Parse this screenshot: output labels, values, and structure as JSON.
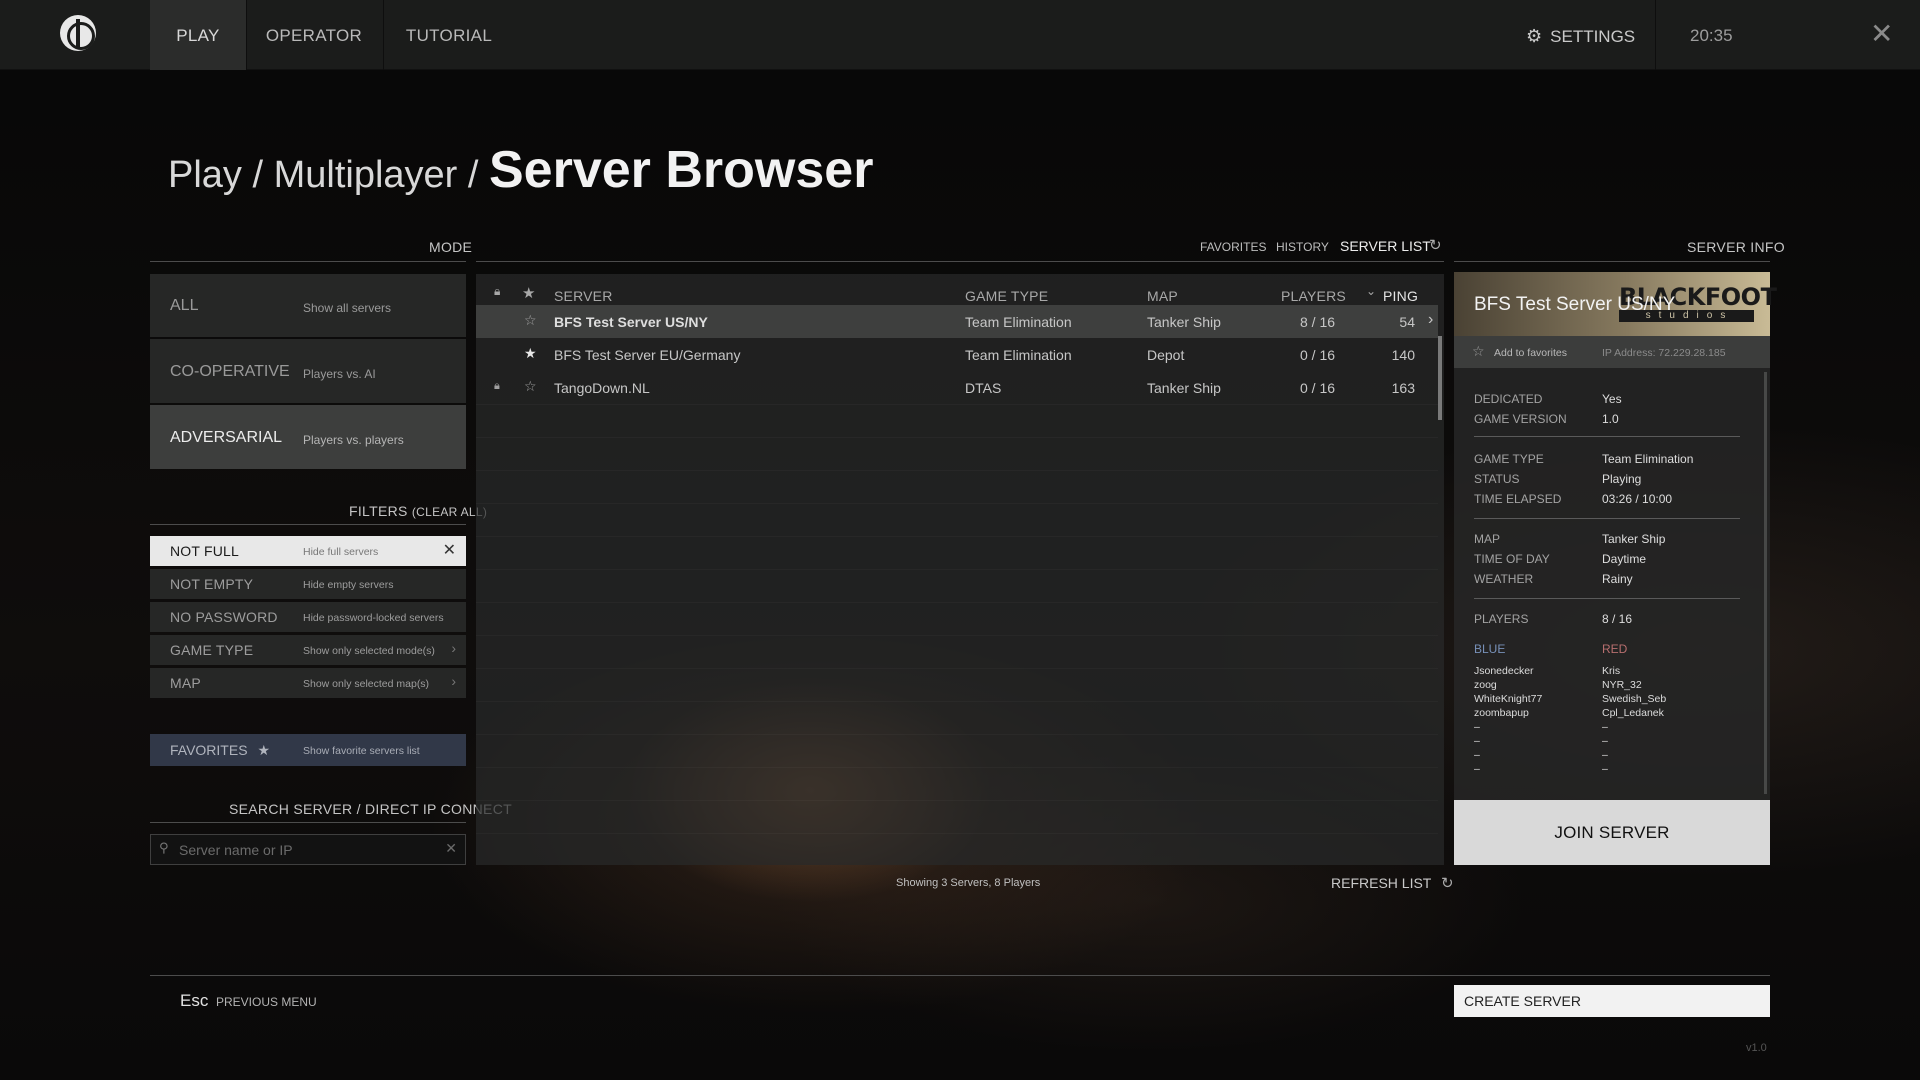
{
  "topbar": {
    "tabs": [
      {
        "label": "PLAY",
        "active": true
      },
      {
        "label": "OPERATOR",
        "active": false
      },
      {
        "label": "TUTORIAL",
        "active": false
      }
    ],
    "settings_label": "SETTINGS",
    "settings_icon": "gear-icon",
    "clock": "20:35",
    "close_icon": "close-icon"
  },
  "title": {
    "breadcrumb": "Play / Multiplayer / ",
    "main": "Server Browser"
  },
  "mode": {
    "header": "MODE",
    "items": [
      {
        "label": "ALL",
        "desc": "Show all servers",
        "active": false
      },
      {
        "label": "CO-OPERATIVE",
        "desc": "Players vs. AI",
        "active": false
      },
      {
        "label": "ADVERSARIAL",
        "desc": "Players vs. players",
        "active": true
      }
    ]
  },
  "filters": {
    "header": "FILTERS",
    "clear_all": "(CLEAR ALL)",
    "items": [
      {
        "label": "NOT FULL",
        "desc": "Hide full servers",
        "active": true,
        "icon": "close-icon",
        "glyph": "✕"
      },
      {
        "label": "NOT EMPTY",
        "desc": "Hide empty servers",
        "active": false,
        "icon": "",
        "glyph": ""
      },
      {
        "label": "NO PASSWORD",
        "desc": "Hide password-locked servers",
        "active": false,
        "icon": "",
        "glyph": ""
      },
      {
        "label": "GAME TYPE",
        "desc": "Show only selected mode(s)",
        "active": false,
        "icon": "chevron-right-icon",
        "glyph": "›"
      },
      {
        "label": "MAP",
        "desc": "Show only selected map(s)",
        "active": false,
        "icon": "chevron-right-icon",
        "glyph": "›"
      }
    ],
    "favorites": {
      "label": "FAVORITES",
      "desc": "Show favorite servers list",
      "icon": "star-icon"
    }
  },
  "search": {
    "header": "SEARCH SERVER / DIRECT IP CONNECT",
    "placeholder": "Server name or IP",
    "value": ""
  },
  "server_list": {
    "tabs": [
      {
        "label": "FAVORITES",
        "active": false
      },
      {
        "label": "HISTORY",
        "active": false
      },
      {
        "label": "SERVER LIST",
        "active": true
      }
    ],
    "columns": {
      "server": "SERVER",
      "game_type": "GAME TYPE",
      "map": "MAP",
      "players": "PLAYERS",
      "ping": "PING",
      "sort_indicator": "⌄"
    },
    "rows": [
      {
        "locked": false,
        "favorite": false,
        "name": "BFS Test Server US/NY",
        "game_type": "Team Elimination",
        "map": "Tanker Ship",
        "players": "8 / 16",
        "ping": "54",
        "selected": true
      },
      {
        "locked": false,
        "favorite": true,
        "name": "BFS Test Server EU/Germany",
        "game_type": "Team Elimination",
        "map": "Depot",
        "players": "0 / 16",
        "ping": "140",
        "selected": false
      },
      {
        "locked": true,
        "favorite": false,
        "name": "TangoDown.NL",
        "game_type": "DTAS",
        "map": "Tanker Ship",
        "players": "0 / 16",
        "ping": "163",
        "selected": false
      }
    ],
    "footer_count": "Showing 3 Servers, 8 Players",
    "refresh_label": "REFRESH LIST"
  },
  "server_info": {
    "header": "SERVER INFO",
    "name": "BFS Test Server US/NY",
    "logo_top": "BLACKFOOT",
    "logo_bottom": "studios",
    "add_favorites": "Add to favorites",
    "ip": "IP Address: 72.229.28.185",
    "details": [
      {
        "key": "DEDICATED",
        "value": "Yes"
      },
      {
        "key": "GAME VERSION",
        "value": "1.0"
      },
      {
        "key": "GAME TYPE",
        "value": "Team Elimination"
      },
      {
        "key": "STATUS",
        "value": "Playing"
      },
      {
        "key": "TIME ELAPSED",
        "value": "03:26 / 10:00"
      },
      {
        "key": "MAP",
        "value": "Tanker Ship"
      },
      {
        "key": "TIME OF DAY",
        "value": "Daytime"
      },
      {
        "key": "WEATHER",
        "value": "Rainy"
      },
      {
        "key": "PLAYERS",
        "value": "8 / 16"
      }
    ],
    "team_blue": "BLUE",
    "team_red": "RED",
    "blue_players": [
      "Jsonedecker",
      "zoog",
      "WhiteKnight77",
      "zoombapup",
      "–",
      "–",
      "–",
      "–"
    ],
    "red_players": [
      "Kris",
      "NYR_32",
      "Swedish_Seb",
      "Cpl_Ledanek",
      "–",
      "–",
      "–",
      "–"
    ],
    "join_label": "JOIN SERVER"
  },
  "bottom": {
    "esc_key": "Esc",
    "esc_label": "PREVIOUS MENU",
    "create_label": "CREATE SERVER",
    "version": "v1.0"
  },
  "colors": {
    "accent_fav": "#313848",
    "blue_team": "#7790b8",
    "red_team": "#b86f6f"
  }
}
